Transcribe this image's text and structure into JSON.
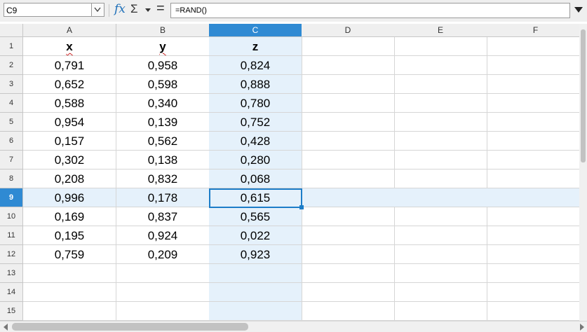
{
  "name_box": {
    "value": "C9"
  },
  "formula_bar": {
    "fx_label": "fx",
    "sum_symbol": "Σ",
    "equals_symbol": "=",
    "formula": "=RAND()"
  },
  "columns": [
    "A",
    "B",
    "C",
    "D",
    "E",
    "F"
  ],
  "rows": [
    "1",
    "2",
    "3",
    "4",
    "5",
    "6",
    "7",
    "8",
    "9",
    "10",
    "11",
    "12",
    "13",
    "14",
    "15"
  ],
  "selected": {
    "column": "C",
    "row": "9"
  },
  "sheet": {
    "header": [
      "x",
      "y",
      "z"
    ],
    "data": [
      [
        "0,791",
        "0,958",
        "0,824"
      ],
      [
        "0,652",
        "0,598",
        "0,888"
      ],
      [
        "0,588",
        "0,340",
        "0,780"
      ],
      [
        "0,954",
        "0,139",
        "0,752"
      ],
      [
        "0,157",
        "0,562",
        "0,428"
      ],
      [
        "0,302",
        "0,138",
        "0,280"
      ],
      [
        "0,208",
        "0,832",
        "0,068"
      ],
      [
        "0,996",
        "0,178",
        "0,615"
      ],
      [
        "0,169",
        "0,837",
        "0,565"
      ],
      [
        "0,195",
        "0,924",
        "0,022"
      ],
      [
        "0,759",
        "0,209",
        "0,923"
      ]
    ]
  },
  "colors": {
    "selection_header": "#2f8ad3",
    "highlight": "#e5f1fb",
    "cell_cursor": "#1c7dc8"
  }
}
